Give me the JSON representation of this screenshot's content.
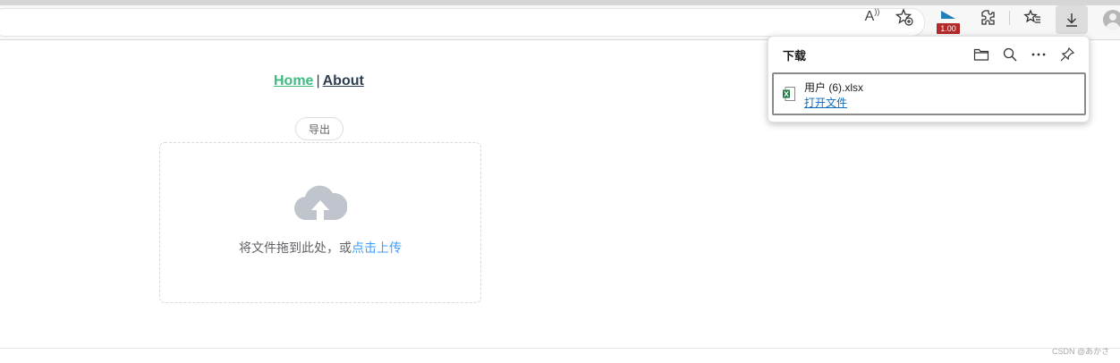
{
  "browser": {
    "toolbar_icons": [
      "read-aloud-icon",
      "add-favorite-icon",
      "extension-icon",
      "extensions-icon",
      "favorites-icon",
      "downloads-icon",
      "profile-icon"
    ],
    "read_aloud_label": "A",
    "extension_badge": "1.00"
  },
  "nav": {
    "home": "Home",
    "separator": "|",
    "about": "About"
  },
  "actions": {
    "export_label": "导出"
  },
  "upload": {
    "text": "将文件拖到此处，或",
    "link": "点击上传"
  },
  "downloads_panel": {
    "title": "下载",
    "items": [
      {
        "file_name": "用户 (6).xlsx",
        "action_label": "打开文件"
      }
    ]
  },
  "watermark": "CSDN @あかさ",
  "colors": {
    "nav_active": "#42b983",
    "nav_text": "#2c3e50",
    "link_blue": "#409eff",
    "download_link": "#0f6cbd",
    "badge_red": "#b22a2a",
    "upload_icon_gray": "#c0c4cc"
  }
}
